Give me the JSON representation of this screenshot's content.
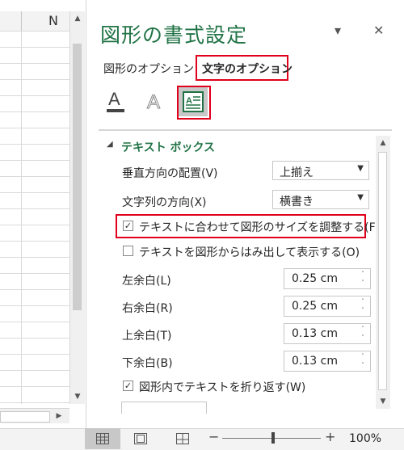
{
  "sheet": {
    "column_label": "N"
  },
  "pane": {
    "title": "図形の書式設定",
    "dropdown_glyph": "▾",
    "close_glyph": "✕",
    "tabs": [
      {
        "label": "図形のオプション"
      },
      {
        "label": "文字のオプション"
      }
    ],
    "section": {
      "title": "テキスト ボックス",
      "collapse_glyph": "◢"
    },
    "vertical_alignment": {
      "label": "垂直方向の配置(V)",
      "value": "上揃え"
    },
    "text_direction": {
      "label": "文字列の方向(X)",
      "value": "横書き"
    },
    "autofit": {
      "label": "テキストに合わせて図形のサイズを調整する(F)",
      "checked": true
    },
    "overflow": {
      "label": "テキストを図形からはみ出して表示する(O)",
      "checked": false
    },
    "margins": [
      {
        "label": "左余白(L)",
        "value": "0.25 cm"
      },
      {
        "label": "右余白(R)",
        "value": "0.25 cm"
      },
      {
        "label": "上余白(T)",
        "value": "0.13 cm"
      },
      {
        "label": "下余白(B)",
        "value": "0.13 cm"
      }
    ],
    "wrap": {
      "label": "図形内でテキストを折り返す(W)",
      "checked": true
    }
  },
  "glyphs": {
    "check": "✓",
    "up": "▲",
    "down": "▼",
    "left": "◀",
    "right": "▶",
    "spin_up": "˄",
    "spin_down": "˅"
  },
  "status": {
    "zoom_minus": "−",
    "zoom_plus": "+",
    "zoom": "100%",
    "zoom_level_percent": 100
  },
  "colors": {
    "accent": "#217346",
    "highlight": "#e0001b"
  }
}
